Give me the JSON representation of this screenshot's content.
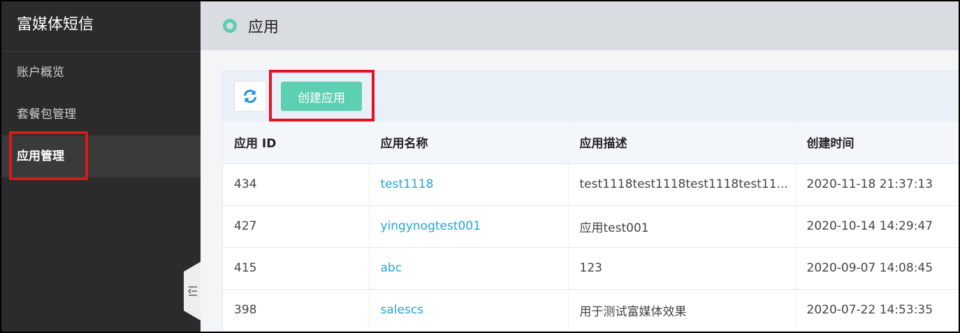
{
  "sidebar": {
    "brand": "富媒体短信",
    "items": [
      {
        "label": "账户概览"
      },
      {
        "label": "套餐包管理"
      },
      {
        "label": "应用管理"
      }
    ],
    "collapse_icon": "collapse-left-icon"
  },
  "header": {
    "title": "应用"
  },
  "toolbar": {
    "refresh_icon": "refresh-icon",
    "create_label": "创建应用"
  },
  "table": {
    "headers": [
      "应用 ID",
      "应用名称",
      "应用描述",
      "创建时间"
    ],
    "rows": [
      [
        "434",
        "test1118",
        "test1118test1118test1118test11...",
        "2020-11-18 21:37:13"
      ],
      [
        "427",
        "yingynogtest001",
        "应用test001",
        "2020-10-14 14:29:47"
      ],
      [
        "415",
        "abc",
        "123",
        "2020-09-07 14:08:45"
      ],
      [
        "398",
        "salescs",
        "用于测试富媒体效果",
        "2020-07-22 14:53:35"
      ]
    ]
  },
  "colors": {
    "accent": "#5dcfb2",
    "link": "#21a5d8",
    "sidebar_bg": "#2b2b2b",
    "highlight": "#e0141e"
  }
}
